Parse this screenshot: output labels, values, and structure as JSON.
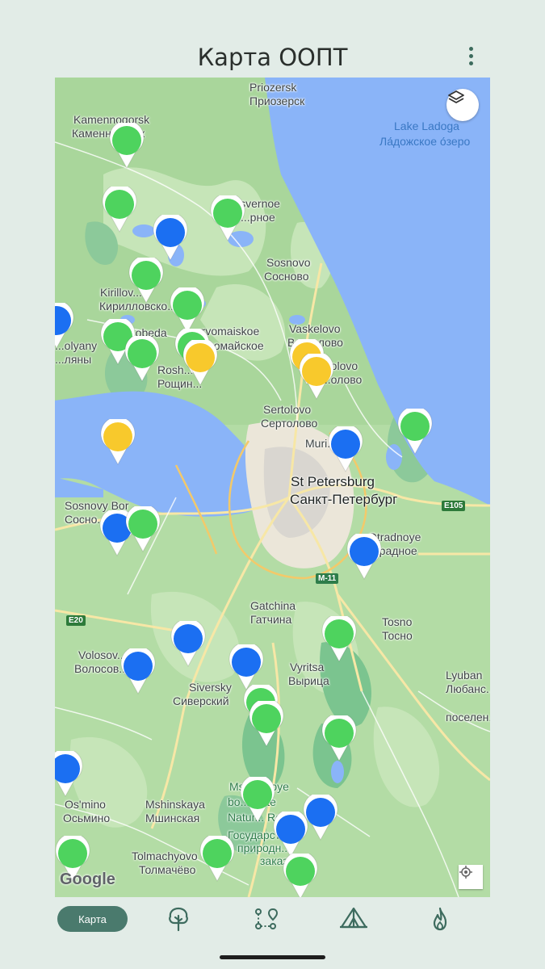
{
  "app": {
    "title": "Карта ООПТ",
    "menu_icon": "more-vert-icon"
  },
  "map": {
    "labels": {
      "priozersk_en": "Priozersk",
      "priozersk_ru": "Приозерск",
      "kamennogorsk_en": "Kamennogorsk",
      "kamennogorsk_ru": "Каменногорск",
      "lake_ladoga_en": "Lake Ladoga",
      "lake_ladoga_ru": "Ла́дожское о́зеро",
      "snovernoe_en": "Sosvernoe",
      "snovernoe_ru": "...рное",
      "sosnovo_en": "Sosnovo",
      "sosnovo_ru": "Сосново",
      "kirillovskoe_en": "Kirillov...",
      "kirillovskoe_ru": "Кирилловско...",
      "pobeda_en": "...obeda",
      "pervomaiskoe_en": "...rvomaiskoe",
      "pervomaiskoe_ru": "...рвомайское",
      "vaskelovo_en": "Vaskelovo",
      "vaskelovo_ru": "Васкелово",
      "polyany_en": "...olyany",
      "polyany_ru": "...ляны",
      "roshchino_en": "Rosh...",
      "roshchino_ru": "Рощин...",
      "toksovo_en": "...olovo",
      "toksovo_ru": "...олово",
      "sertolovo_en": "Sertolovo",
      "sertolovo_ru": "Сертолово",
      "murino": "Muri...",
      "stpetersburg_en": "St Petersburg",
      "stpetersburg_ru": "Санкт-Петербург",
      "sosnovy_bor_en": "Sosnovy Bor",
      "sosnovy_bor_ru": "Сосно...",
      "otradnoye_en": "Otradnoye",
      "otradnoye_ru": "...радное",
      "gatchina_en": "Gatchina",
      "gatchina_ru": "Гатчина",
      "tosno_en": "Tosno",
      "tosno_ru": "Тосно",
      "volosovo_en": "Volosov...",
      "volosovo_ru": "Волосов...",
      "vyritsa_en": "Vyritsa",
      "vyritsa_ru": "Вырица",
      "siversky_en": "Siversky",
      "siversky_ru": "Сиверский",
      "lyuban_en": "Lyuban",
      "lyuban_ru": "Любанс...",
      "lyuban_ru2": "поселен...",
      "osmino_en": "Os'mino",
      "osmino_ru": "Осьмино",
      "mshinskaya_en": "Mshinskaya",
      "mshinskaya_ru": "Мшинская",
      "mshinskoye_1": "Mshinskoye",
      "mshinskoye_2": "bo...State",
      "mshinskoye_3": "Natur... Reserv",
      "mshinskoye_ru1": "Государстве...",
      "mshinskoye_ru2": "природн...",
      "mshinskoye_ru3": "заказник",
      "tolmachevo_en": "Tolmachyovo",
      "tolmachevo_ru": "Толмачёво",
      "google": "Google"
    },
    "shields": {
      "e105": "E105",
      "m11": "M-11",
      "e20": "E20"
    },
    "markers": [
      {
        "color": "green"
      },
      {
        "color": "green"
      },
      {
        "color": "blue"
      },
      {
        "color": "green"
      },
      {
        "color": "green"
      },
      {
        "color": "green"
      },
      {
        "color": "blue"
      },
      {
        "color": "green"
      },
      {
        "color": "green"
      },
      {
        "color": "green"
      },
      {
        "color": "yellow"
      },
      {
        "color": "yellow"
      },
      {
        "color": "yellow"
      },
      {
        "color": "green"
      },
      {
        "color": "yellow"
      },
      {
        "color": "blue"
      },
      {
        "color": "blue"
      },
      {
        "color": "green"
      },
      {
        "color": "blue"
      },
      {
        "color": "green"
      },
      {
        "color": "blue"
      },
      {
        "color": "blue"
      },
      {
        "color": "blue"
      },
      {
        "color": "green"
      },
      {
        "color": "green"
      },
      {
        "color": "green"
      },
      {
        "color": "blue"
      },
      {
        "color": "green"
      },
      {
        "color": "blue"
      },
      {
        "color": "blue"
      },
      {
        "color": "green"
      },
      {
        "color": "green"
      },
      {
        "color": "green"
      }
    ],
    "colors": {
      "green": "#4ed35e",
      "blue": "#1b6ff2",
      "yellow": "#f8c92c"
    },
    "layers_icon": "layers-icon",
    "location_icon": "my-location-icon"
  },
  "nav": {
    "active_label": "Карта",
    "items": [
      {
        "icon": "map-tab",
        "label": "Карта"
      },
      {
        "icon": "tree-icon"
      },
      {
        "icon": "route-icon"
      },
      {
        "icon": "tent-icon"
      },
      {
        "icon": "fire-icon"
      }
    ]
  }
}
